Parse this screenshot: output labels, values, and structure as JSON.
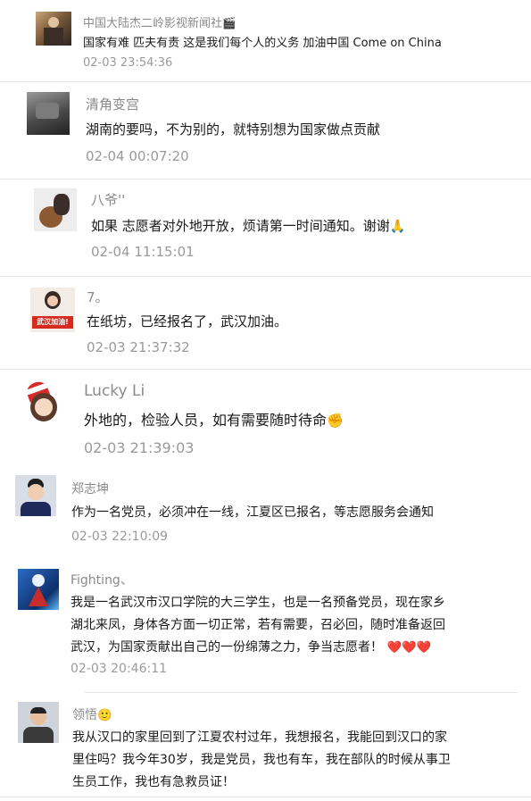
{
  "comments": [
    {
      "name": "中国大陆杰二岭影视新闻社",
      "name_emoji": "🎬",
      "text": "国家有难 匹夫有责 这是我们每个人的义务 加油中国 Come on China",
      "time": "02-03 23:54:36"
    },
    {
      "name": "清角变宫",
      "text": "湖南的要吗，不为别的，就特别想为国家做点贡献",
      "time": "02-04 00:07:20"
    },
    {
      "name": "八爷''",
      "text": "如果 志愿者对外地开放，烦请第一时间通知。谢谢",
      "text_emoji": "🙏",
      "time": "02-04 11:15:01"
    },
    {
      "name": "7。",
      "avatar_label": "武汉加油!",
      "text": "在纸坊，已经报名了，武汉加油。",
      "time": "02-03 21:37:32"
    },
    {
      "name": "Lucky Li",
      "text": "外地的，检验人员，如有需要随时待命",
      "text_emoji": "✊",
      "time": "02-03 21:39:03"
    },
    {
      "name": "郑志坤",
      "text": "作为一名党员，必须冲在一线，江夏区已报名，等志愿服务会通知",
      "time": "02-03 22:10:09"
    },
    {
      "name": "Fighting、",
      "text_lines": [
        "我是一名武汉市汉口学院的大三学生，也是一名预备党员，现在家乡",
        "湖北来凤，身体各方面一切正常，若有需要，召必回，随时准备返回",
        "武汉，为国家贡献出自己的一份绵薄之力，争当志愿者！"
      ],
      "text_emoji": "❤️❤️❤️",
      "time": "02-03 20:46:11"
    },
    {
      "name": "领悟",
      "name_emoji": "🙂",
      "text_lines": [
        "我从汉口的家里回到了江夏农村过年，我想报名，我能回到汉口的家",
        "里住吗？我今年30岁，我是党员，我也有车，我在部队的时候从事卫",
        "生员工作，我也有急救员证！"
      ]
    }
  ]
}
